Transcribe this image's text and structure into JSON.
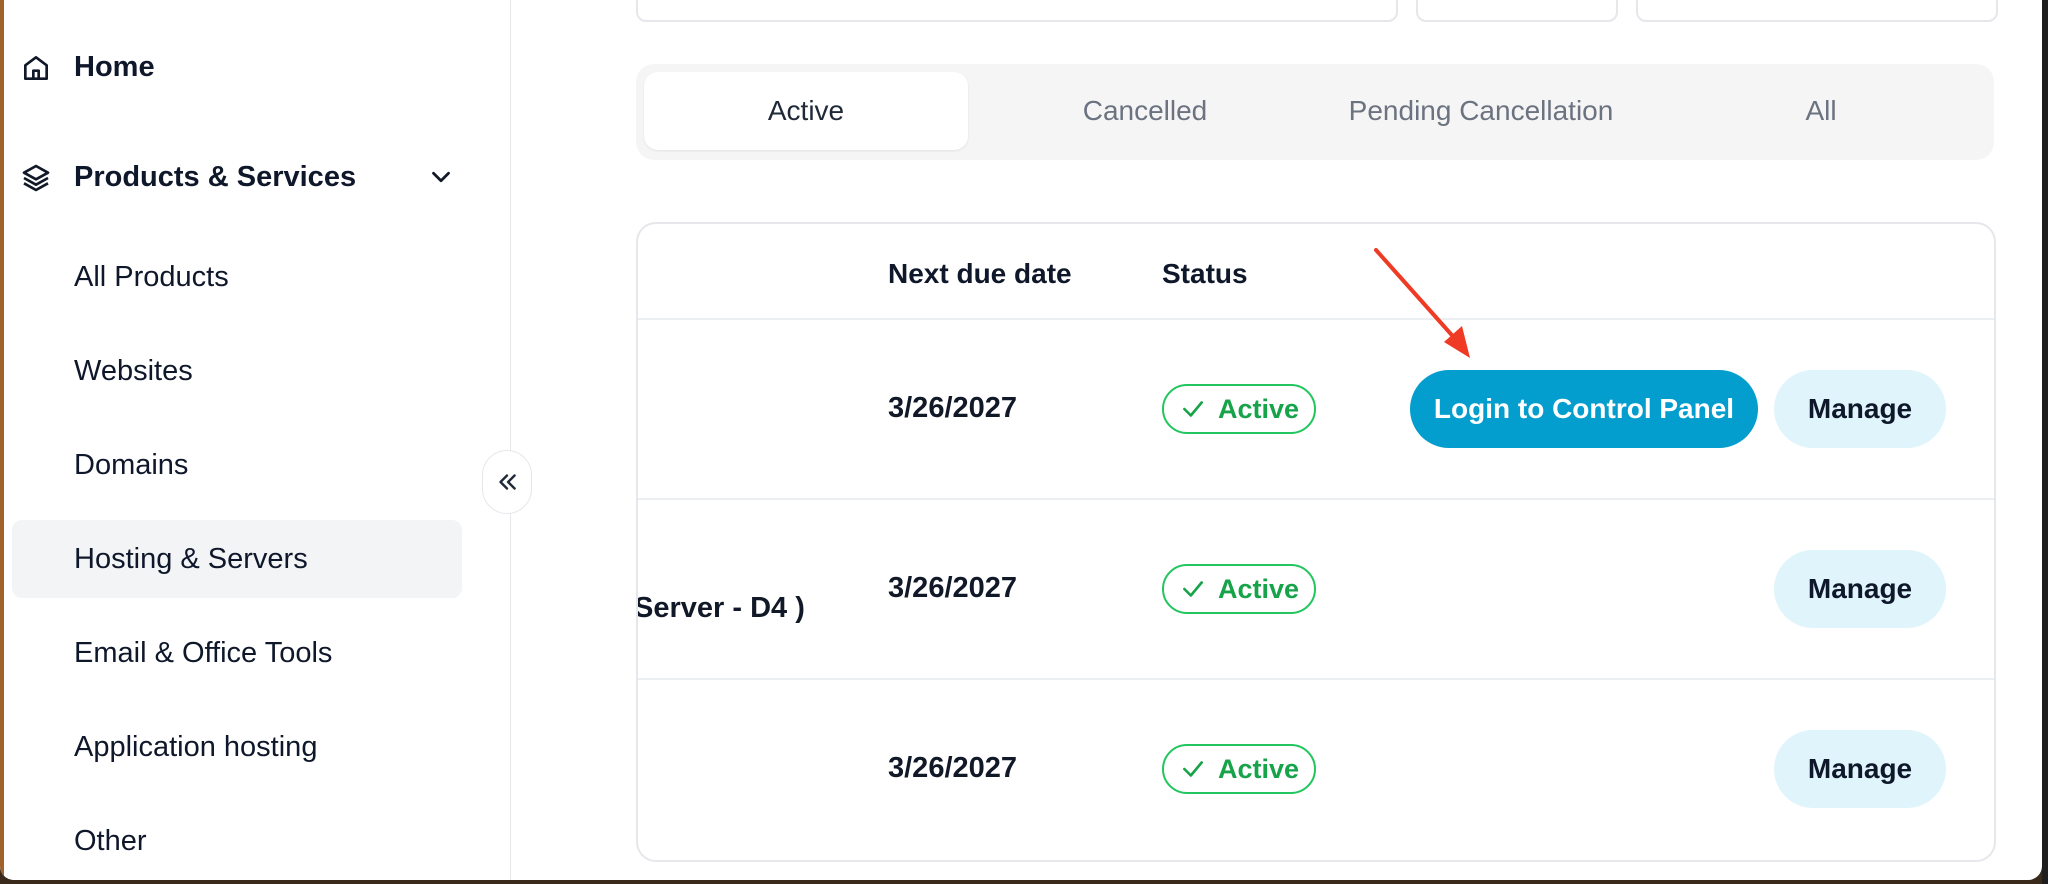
{
  "sidebar": {
    "home_label": "Home",
    "products_label": "Products & Services",
    "items": [
      {
        "label": "All Products"
      },
      {
        "label": "Websites"
      },
      {
        "label": "Domains"
      },
      {
        "label": "Hosting & Servers"
      },
      {
        "label": "Email & Office Tools"
      },
      {
        "label": "Application hosting"
      },
      {
        "label": "Other"
      }
    ],
    "selected_item": "Hosting & Servers"
  },
  "tabs": [
    {
      "label": "Active"
    },
    {
      "label": "Cancelled"
    },
    {
      "label": "Pending Cancellation"
    },
    {
      "label": "All"
    }
  ],
  "active_tab": "Active",
  "table": {
    "headers": {
      "next_due": "Next due date",
      "status": "Status"
    },
    "rows": [
      {
        "product": "",
        "next_due": "3/26/2027",
        "status": "Active",
        "login_label": "Login to Control Panel",
        "manage_label": "Manage"
      },
      {
        "product": "Server - D4 )",
        "next_due": "3/26/2027",
        "status": "Active",
        "manage_label": "Manage"
      },
      {
        "product": "",
        "next_due": "3/26/2027",
        "status": "Active",
        "manage_label": "Manage"
      }
    ]
  },
  "colors": {
    "primary_button": "#049ece",
    "manage_button": "#e0f4fb",
    "status_green": "#16a34a",
    "annotation_arrow": "#ef3b24"
  }
}
